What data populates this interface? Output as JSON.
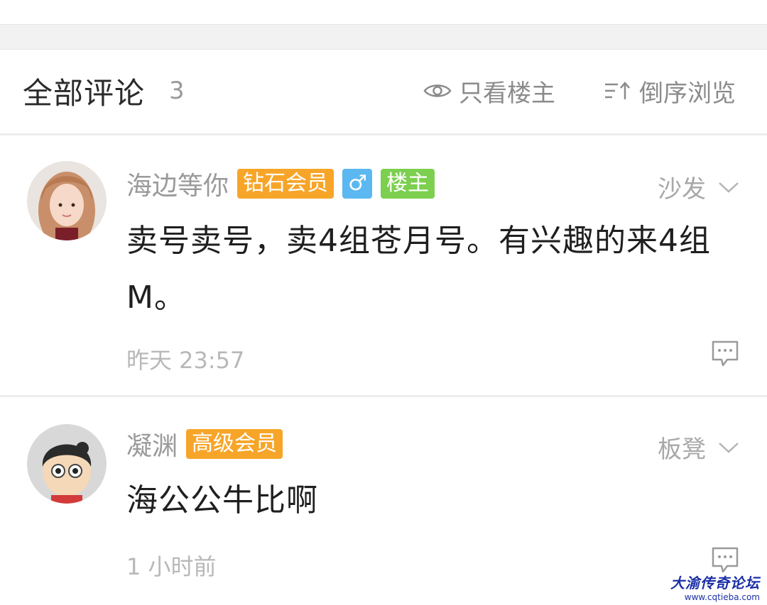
{
  "header": {
    "title": "全部评论",
    "count": "3",
    "filter_label": "只看楼主",
    "sort_label": "倒序浏览"
  },
  "posts": [
    {
      "username": "海边等你",
      "badges": [
        "钻石会员",
        "♂",
        "楼主"
      ],
      "floor": "沙发",
      "content": "卖号卖号，卖4组苍月号。有兴趣的来4组M。",
      "time": "昨天 23:57"
    },
    {
      "username": "凝渊",
      "badges": [
        "高级会员"
      ],
      "floor": "板凳",
      "content": "海公公牛比啊",
      "time": "1 小时前"
    }
  ],
  "watermark": {
    "title": "大渝传奇论坛",
    "url": "www.cqtieba.com"
  },
  "icons": {
    "filter": "eye-icon",
    "sort": "sort-icon",
    "floor_menu": "chevron-down-icon",
    "reply": "comment-bubble-icon"
  },
  "colors": {
    "diamond_badge": "#f7a529",
    "gender_badge": "#5bb8f0",
    "owner_badge": "#7ccf4f",
    "senior_badge": "#f7a529"
  }
}
